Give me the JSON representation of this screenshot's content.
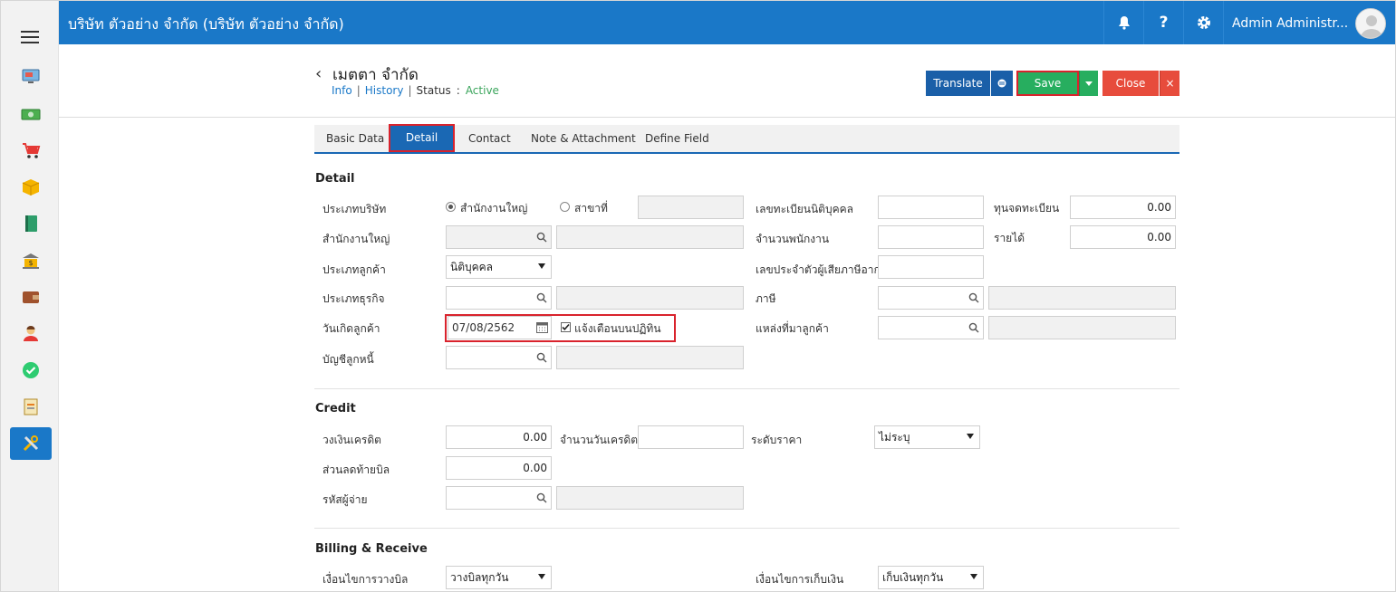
{
  "header": {
    "company_name": "บริษัท ตัวอย่าง จำกัด (บริษัท ตัวอย่าง จำกัด)",
    "user_name": "Admin Administr...",
    "help_label": "?"
  },
  "sidebar": {
    "icons": [
      "monitor-icon",
      "money-icon",
      "cart-icon",
      "box-icon",
      "book-icon",
      "bank-icon",
      "wallet-icon",
      "person-icon",
      "check-icon",
      "document-icon",
      "tools-icon"
    ]
  },
  "page": {
    "back_glyph": "‹",
    "title": "เมตตา จำกัด",
    "info_link": "Info",
    "history_link": "History",
    "status_label": "Status",
    "status_colon": ":",
    "status_value": "Active",
    "sep": "|"
  },
  "actions": {
    "translate_label": "Translate",
    "save_label": "Save",
    "close_label": "Close",
    "close_x": "×"
  },
  "tabs": [
    "Basic Data",
    "Detail",
    "Contact",
    "Note & Attachment",
    "Define Field"
  ],
  "detail": {
    "section_title": "Detail",
    "company_type_label": "ประเภทบริษัท",
    "radio_head_office": "สำนักงานใหญ่",
    "radio_branch": "สาขาที่",
    "head_office_label": "สำนักงานใหญ่",
    "customer_type_label": "ประเภทลูกค้า",
    "customer_type_value": "นิติบุคคล",
    "business_type_label": "ประเภทธุรกิจ",
    "birthday_label": "วันเกิดลูกค้า",
    "birthday_value": "07/08/2562",
    "calendar_notify_label": "แจ้งเตือนบนปฏิทิน",
    "debtor_account_label": "บัญชีลูกหนี้",
    "reg_no_label": "เลขทะเบียนนิติบุคคล",
    "employees_label": "จำนวนพนักงาน",
    "tax_id_label": "เลขประจำตัวผู้เสียภาษีอากร",
    "tax_label": "ภาษี",
    "source_label": "แหล่งที่มาลูกค้า",
    "capital_label": "ทุนจดทะเบียน",
    "capital_value": "0.00",
    "income_label": "รายได้",
    "income_value": "0.00"
  },
  "credit": {
    "section_title": "Credit",
    "credit_limit_label": "วงเงินเครดิต",
    "credit_limit_value": "0.00",
    "credit_days_label": "จำนวนวันเครดิต",
    "price_level_label": "ระดับราคา",
    "price_level_value": "ไม่ระบุ",
    "discount_label": "ส่วนลดท้ายบิล",
    "discount_value": "0.00",
    "payer_code_label": "รหัสผู้จ่าย"
  },
  "billing": {
    "section_title": "Billing & Receive",
    "billing_cond_label": "เงื่อนไขการวางบิล",
    "billing_cond_value": "วางบิลทุกวัน",
    "collect_cond_label": "เงื่อนไขการเก็บเงิน",
    "collect_cond_value": "เก็บเงินทุกวัน"
  },
  "colors": {
    "topbar": "#1a78c8",
    "translate": "#1a5fa8",
    "save": "#27ae5f",
    "close": "#e74c3c",
    "highlight": "#d9232d"
  }
}
